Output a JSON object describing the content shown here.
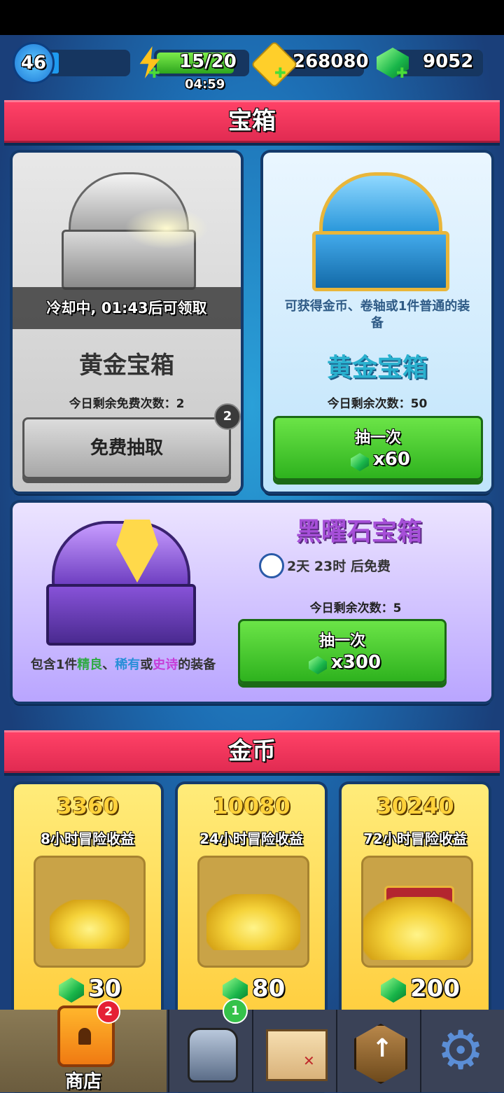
{
  "hud": {
    "level": "46",
    "energy": "15/20",
    "energy_timer": "04:59",
    "gold": "268080",
    "gems": "9052"
  },
  "chests_section": {
    "title": "宝箱",
    "silver": {
      "cooldown": "冷却中, 01:43后可领取",
      "description": "可获得金币、卷轴或1件普通的装备",
      "name": "黄金宝箱",
      "free_remaining": "今日剩余免费次数：2",
      "badge": "2",
      "button": "免费抽取"
    },
    "gold": {
      "description": "可获得金币、卷轴或1件普通的装备",
      "name": "黄金宝箱",
      "remaining": "今日剩余次数：50",
      "button_label": "抽一次",
      "price": "x60"
    },
    "obsidian": {
      "name": "黑曜石宝箱",
      "timer": "2天 23时 后免费",
      "remaining": "今日剩余次数：5",
      "button_label": "抽一次",
      "price": "x300",
      "desc_prefix": "包含1件",
      "desc_fine": "精良",
      "desc_sep": "、",
      "desc_rare": "稀有",
      "desc_or": "或",
      "desc_epic": "史诗",
      "desc_suffix": "的装备"
    }
  },
  "coins_section": {
    "title": "金币",
    "offers": [
      {
        "amount": "3360",
        "label": "8小时冒险收益",
        "price": "30"
      },
      {
        "amount": "10080",
        "label": "24小时冒险收益",
        "price": "80"
      },
      {
        "amount": "30240",
        "label": "72小时冒险收益",
        "price": "200"
      }
    ]
  },
  "nav": {
    "shop_label": "商店",
    "shop_badge": "2",
    "equipment_badge": "1"
  },
  "colors": {
    "fine": "#3ce05a",
    "rare": "#3fb8ff",
    "epic": "#e15bf0",
    "banner": "#ef3459"
  }
}
